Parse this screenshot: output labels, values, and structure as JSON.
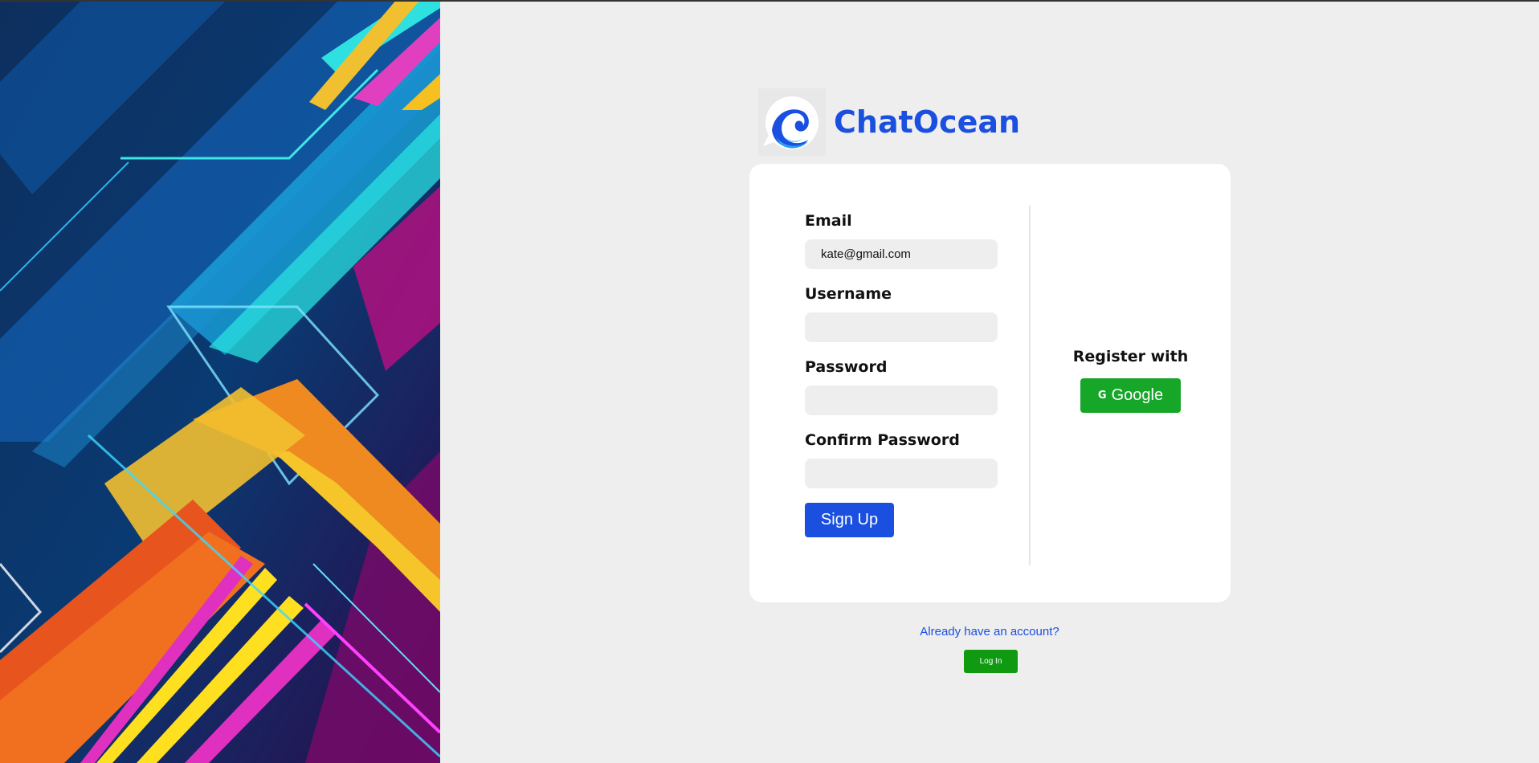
{
  "app": {
    "name": "ChatOcean",
    "brand_color": "#1a4fe0"
  },
  "signup_form": {
    "email_label": "Email",
    "email_value": "kate@gmail.com",
    "username_label": "Username",
    "username_value": "",
    "password_label": "Password",
    "password_value": "",
    "confirm_password_label": "Confirm Password",
    "confirm_password_value": "",
    "submit_label": "Sign Up"
  },
  "social": {
    "title": "Register with",
    "google_label": "Google",
    "google_icon": "google-g-icon",
    "google_color": "#16a628"
  },
  "login": {
    "prompt": "Already have an account?",
    "button_label": "Log In",
    "button_color": "#0f9a12"
  }
}
